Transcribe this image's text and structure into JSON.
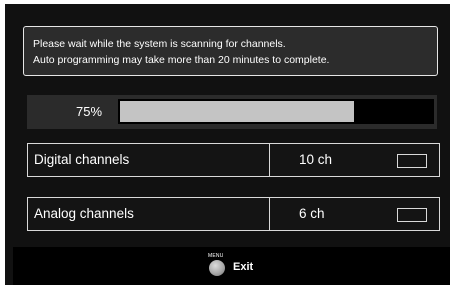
{
  "info": {
    "line1": "Please wait while the system is scanning for channels.",
    "line2": "Auto programming may take more than 20 minutes to complete."
  },
  "progress": {
    "label": "75%",
    "value": 0.75
  },
  "channels": [
    {
      "name": "Digital channels",
      "count": "10 ch"
    },
    {
      "name": "Analog channels",
      "count": "6 ch"
    }
  ],
  "footer": {
    "menu_tag": "MENU",
    "exit_label": "Exit"
  },
  "colors": {
    "screen_bg": "#111111",
    "progress_fill": "#c4c4c4",
    "border": "#d9d9d9"
  }
}
